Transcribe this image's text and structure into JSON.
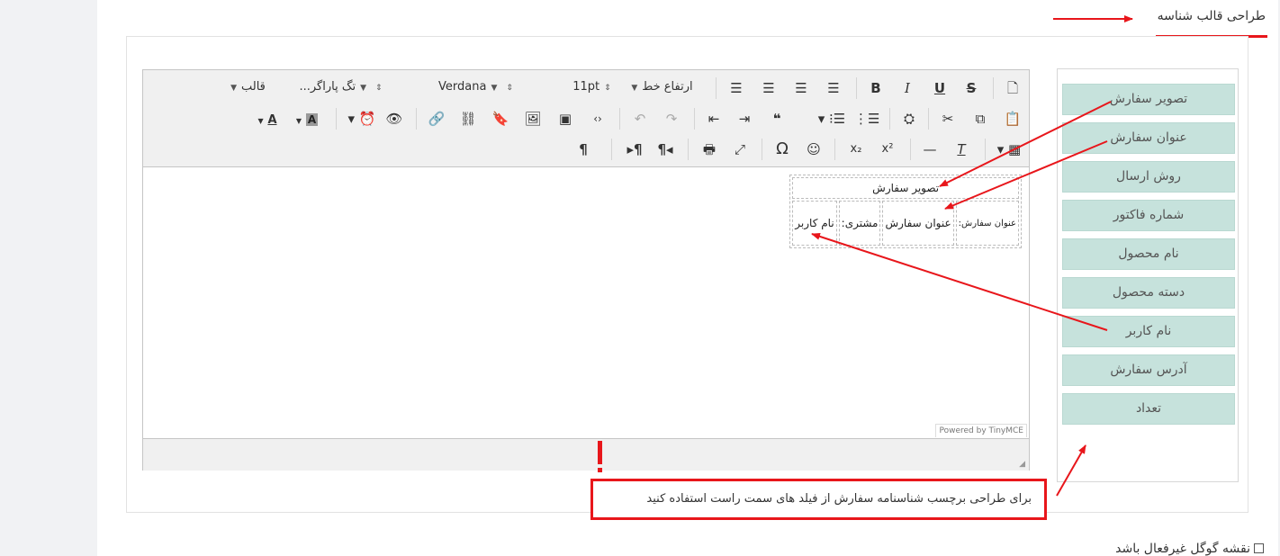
{
  "section": {
    "title": "طراحی قالب شناسه"
  },
  "editor": {
    "toolbar": {
      "row1": {
        "template_label": "قالب",
        "paragraph_tag_label": "تگ پاراگر...",
        "font_family": "Verdana",
        "font_size": "11pt",
        "line_height_label": "ارتفاع خط",
        "bold": "B",
        "italic": "I",
        "underline": "U",
        "strike": "S"
      },
      "row2": {
        "font_color": "A",
        "bg_color": "A",
        "blockquote": "❝"
      },
      "row3": {
        "omega": "Ω",
        "subscript": "x₂",
        "superscript": "x²",
        "pilcrow": "¶"
      }
    },
    "content": {
      "row1_cell": "تصویر سفارش",
      "row2_cells": [
        "عنوان سفارش:",
        "عنوان سفارش",
        "مشتری:",
        "نام کاربر"
      ]
    },
    "powered_by": "Powered by TinyMCE"
  },
  "fields": [
    "تصویر سفارش",
    "عنوان سفارش",
    "روش ارسال",
    "شماره فاکتور",
    "نام محصول",
    "دسته محصول",
    "نام کاربر",
    "آدرس سفارش",
    "تعداد"
  ],
  "hint": "برای طراحی برچسب شناسنامه سفارش از فیلد های سمت راست استفاده کنید",
  "google_map_checkbox_label": "نقشه گوگل غیرفعال باشد",
  "colors": {
    "accent": "#e8161b",
    "field_bg": "#c6e2dc"
  }
}
